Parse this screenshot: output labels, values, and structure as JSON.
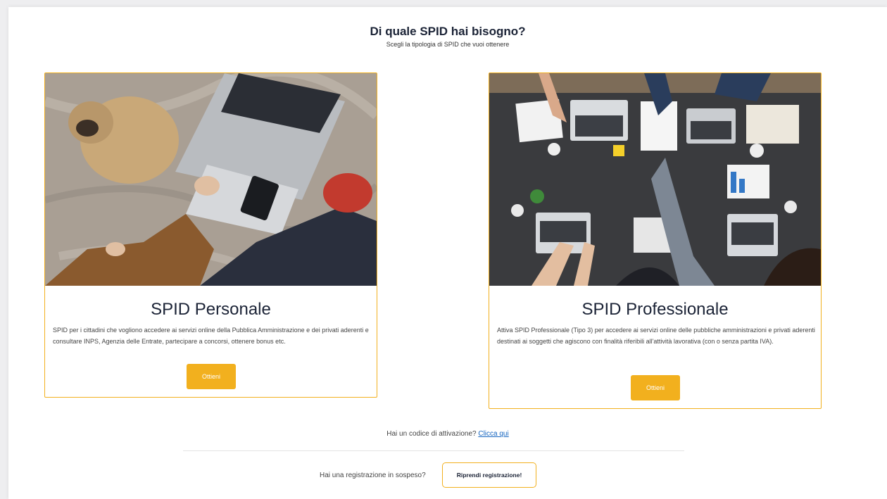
{
  "header": {
    "title": "Di quale SPID hai bisogno?",
    "subtitle": "Scegli la tipologia di SPID che vuoi ottenere"
  },
  "cards": [
    {
      "title": "SPID Personale",
      "description": "SPID per i cittadini che vogliono accedere ai servizi online della Pubblica Amministrazione e dei privati aderenti e consultare INPS, Agenzia delle Entrate, partecipare a concorsi, ottenere bonus etc.",
      "button_label": "Ottieni"
    },
    {
      "title": "SPID Professionale",
      "description": "Attiva SPID Professionale (Tipo 3) per accedere ai servizi online delle pubbliche amministrazioni e privati aderenti destinati ai soggetti che agiscono con finalità riferibili all'attività lavorativa (con o senza partita IVA).",
      "button_label": "Ottieni"
    }
  ],
  "activation": {
    "text": "Hai un codice di attivazione?",
    "link": "Clicca qui"
  },
  "pending": {
    "text": "Hai una registrazione in sospeso?",
    "button_label": "Riprendi registrazione!"
  },
  "colors": {
    "accent": "#f2b01e",
    "heading": "#1b2336",
    "link": "#1565c0"
  }
}
